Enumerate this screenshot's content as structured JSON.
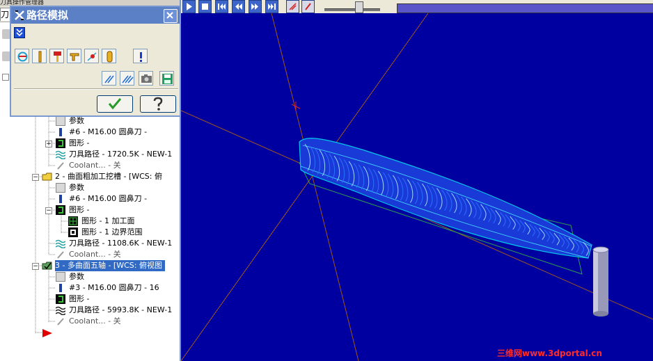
{
  "panel": {
    "title_fragment": "刀具操作管理器",
    "tab_label": "刀"
  },
  "dialog": {
    "title": "路径模拟",
    "close_glyph": "✕"
  },
  "tree": {
    "rows": [
      {
        "label": "参数"
      },
      {
        "label": "#6 - M16.00 圆鼻刀 -"
      },
      {
        "label": "图形 -"
      },
      {
        "label": "刀具路径 - 1720.5K - NEW-1"
      },
      {
        "label": "Coolant... - 关"
      },
      {
        "label": "2 - 曲面粗加工挖槽 - [WCS: 俯"
      },
      {
        "label": "参数"
      },
      {
        "label": "#6 - M16.00 圆鼻刀 -"
      },
      {
        "label": "图形 -"
      },
      {
        "label": "图形 - 1 加工面"
      },
      {
        "label": "图形 - 1 边界范围"
      },
      {
        "label": "刀具路径 - 1108.6K - NEW-1"
      },
      {
        "label": "Coolant... - 关"
      },
      {
        "label": "3 - 多曲面五轴 - [WCS: 俯视图"
      },
      {
        "label": "参数"
      },
      {
        "label": "#3 - M16.00 圆鼻刀 -     16"
      },
      {
        "label": "图形 -"
      },
      {
        "label": "刀具路径 - 5993.8K - NEW-1"
      },
      {
        "label": "Coolant... - 关"
      }
    ]
  },
  "colors": {
    "viewport_bg": "#0000a0",
    "toolpath": "#1f5cff",
    "selection": "#316ac5",
    "dialog_title": "#5b80c6"
  },
  "watermark": "三维网www.3dportal.cn"
}
